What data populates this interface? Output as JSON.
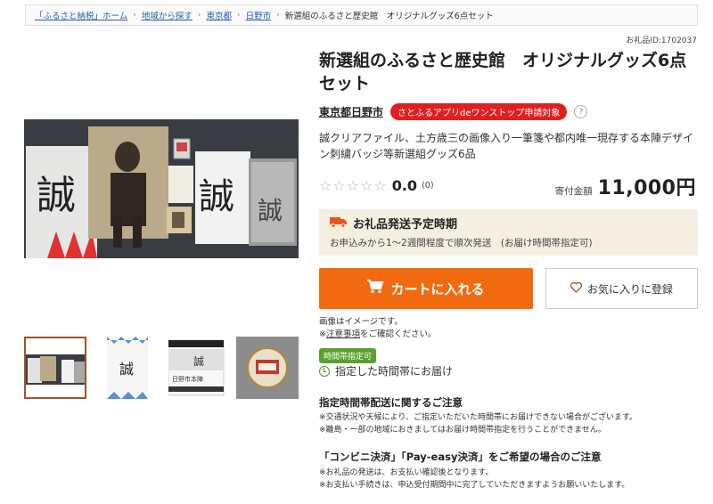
{
  "breadcrumb": [
    "「ふるさと納税」ホーム",
    "地域から探す",
    "東京都",
    "日野市",
    "新選組のふるさと歴史館　オリジナルグッズ6点セット"
  ],
  "item_id": "お礼品ID:1702037",
  "title": "新選組のふるさと歴史館　オリジナルグッズ6点セット",
  "seller": "東京都日野市",
  "app_badge": "さとふるアプリdeワンストップ申請対象",
  "help_icon": "?",
  "description": "誠クリアファイル、土方歳三の画像入り一筆箋や都内唯一現存する本陣デザイン刺繍バッジ等新選組グッズ6品",
  "rating": {
    "score": "0.0",
    "count": "(0)",
    "stars": 0,
    "max_stars": 5
  },
  "price": {
    "label": "寄付金額",
    "value": "11,000円"
  },
  "shipping": {
    "title": "お礼品発送予定時期",
    "detail": "お申込みから1～2週間程度で順次発送　(お届け時間帯指定可)"
  },
  "buttons": {
    "cart": "カートに入れる",
    "favorite": "お気に入りに登録"
  },
  "image_note": {
    "line1": "画像はイメージです。",
    "line2_prefix": "※",
    "line2_link": "注意事項",
    "line2_suffix": "をご確認ください。"
  },
  "time_badge": "時間帯指定可",
  "time_text": "指定した時間帯にお届け",
  "notice1": {
    "title": "指定時間帯配送に関するご注意",
    "line1": "※交通状況や天候により、ご指定いただいた時間帯にお届けできない場合がございます。",
    "line2": "※離島・一部の地域におきましてはお届け時間帯指定を行うことができません。"
  },
  "notice2": {
    "title": "「コンビニ決済」「Pay-easy決済」をご希望の場合のご注意",
    "line1": "※お礼品の発送は、お支払い確認後となります。",
    "line2": "※お支払い手続きは、申込受付期間中に完了していただきますようお願いいたします。"
  },
  "main_image_text": [
    "誠",
    "誠",
    "誠"
  ],
  "thumb_texts": [
    "誠",
    "誠",
    "日野市本陣"
  ],
  "colors": {
    "accent": "#f26a10",
    "badge_red": "#e02020",
    "green": "#5aa02c",
    "ship_bg": "#f5efe2"
  },
  "icons": [
    "truck-icon",
    "cart-icon",
    "heart-icon",
    "clock-icon",
    "star-icon",
    "help-icon"
  ]
}
